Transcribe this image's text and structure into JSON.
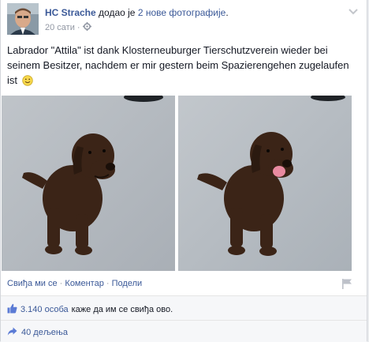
{
  "post": {
    "author": "HC Strache",
    "action_prefix": "додао је",
    "action_link": "2 нове фотографије",
    "action_suffix": ".",
    "time": "20 сати",
    "separator": "·",
    "audience_icon": "gear-icon",
    "text": "Labrador \"Attila\" ist dank Klosterneuburger Tierschutzverein wieder bei seinem Besitzer, nachdem er mir gestern beim Spazierengehen zugelaufen ist",
    "emoji": "smiley-emoji"
  },
  "actions": {
    "like": "Свиђа ми се",
    "comment": "Коментар",
    "share": "Подели",
    "dot": "·"
  },
  "likes": {
    "count": "3.140 особа",
    "suffix": "каже да им се свиђа ово."
  },
  "shares": {
    "label": "40 дељења"
  },
  "colors": {
    "link": "#3b5998",
    "meta": "#9197a3",
    "footer_bg": "#f6f7f9"
  }
}
